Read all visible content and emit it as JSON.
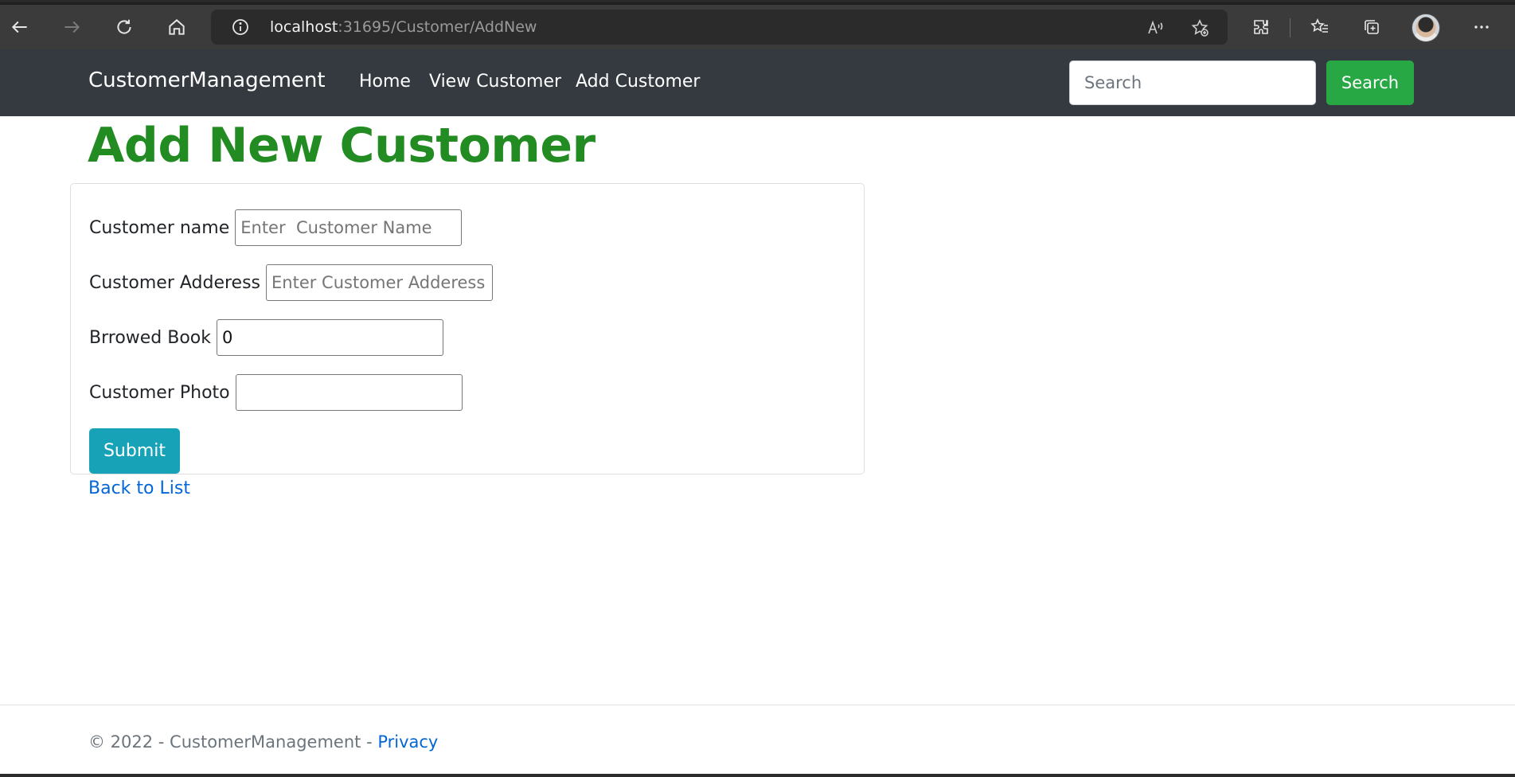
{
  "browser": {
    "url_host": "localhost",
    "url_path": ":31695/Customer/AddNew",
    "icons": {
      "back": "back-arrow-icon",
      "forward": "forward-arrow-icon",
      "refresh": "refresh-icon",
      "home": "home-icon",
      "info": "info-icon",
      "read_aloud": "read-aloud-icon",
      "add_favorite": "add-favorite-icon",
      "extensions": "extensions-icon",
      "favorites": "favorites-icon",
      "collections": "collections-icon",
      "menu": "more-menu-icon"
    }
  },
  "navbar": {
    "brand": "CustomerManagement",
    "links": [
      {
        "label": "Home"
      },
      {
        "label": "View Customer"
      },
      {
        "label": "Add Customer"
      }
    ],
    "search_placeholder": "Search",
    "search_button": "Search"
  },
  "page": {
    "title": "Add New Customer",
    "fields": [
      {
        "label": "Customer name",
        "placeholder": "Enter  Customer Name",
        "value": ""
      },
      {
        "label": "Customer Adderess",
        "placeholder": "Enter Customer Adderess",
        "value": ""
      },
      {
        "label": "Brrowed Book",
        "placeholder": "",
        "value": "0"
      },
      {
        "label": "Customer Photo",
        "placeholder": "",
        "value": ""
      }
    ],
    "submit_label": "Submit",
    "back_link": "Back to List"
  },
  "footer": {
    "text": "© 2022 - CustomerManagement - ",
    "privacy_link": "Privacy"
  },
  "colors": {
    "navbar_bg": "#343a40",
    "title_green": "#228b22",
    "search_button_green": "#28a745",
    "submit_teal": "#17a2b8",
    "link_blue": "#0366d6"
  }
}
